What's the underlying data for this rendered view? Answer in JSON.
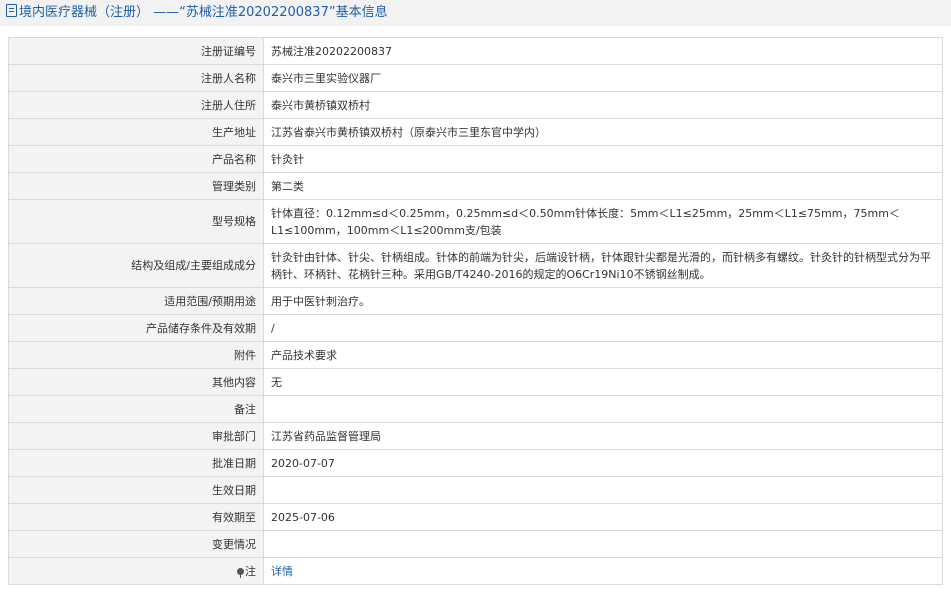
{
  "header": {
    "title": "境内医疗器械（注册） ——“苏械注准20202200837”基本信息",
    "icon": "document-icon"
  },
  "rows": [
    {
      "label": "注册证编号",
      "value": "苏械注准20202200837"
    },
    {
      "label": "注册人名称",
      "value": "泰兴市三里实验仪器厂"
    },
    {
      "label": "注册人住所",
      "value": "泰兴市黄桥镇双桥村"
    },
    {
      "label": "生产地址",
      "value": "江苏省泰兴市黄桥镇双桥村（原泰兴市三里东官中学内）"
    },
    {
      "label": "产品名称",
      "value": "针灸针"
    },
    {
      "label": "管理类别",
      "value": "第二类"
    },
    {
      "label": "型号规格",
      "value": "针体直径：0.12mm≤d＜0.25mm，0.25mm≤d＜0.50mm针体长度：5mm＜L1≤25mm，25mm＜L1≤75mm，75mm＜L1≤100mm，100mm＜L1≤200mm支/包装"
    },
    {
      "label": "结构及组成/主要组成成分",
      "value": "针灸针由针体、针尖、针柄组成。针体的前端为针尖，后端设针柄，针体跟针尖都是光滑的，而针柄多有螺纹。针灸针的针柄型式分为平柄针、环柄针、花柄针三种。采用GB/T4240-2016的规定的O6Cr19Ni10不锈钢丝制成。"
    },
    {
      "label": "适用范围/预期用途",
      "value": "用于中医针刺治疗。"
    },
    {
      "label": "产品储存条件及有效期",
      "value": "/"
    },
    {
      "label": "附件",
      "value": "产品技术要求"
    },
    {
      "label": "其他内容",
      "value": "无"
    },
    {
      "label": "备注",
      "value": ""
    },
    {
      "label": "审批部门",
      "value": "江苏省药品监督管理局"
    },
    {
      "label": "批准日期",
      "value": "2020-07-07"
    },
    {
      "label": "生效日期",
      "value": ""
    },
    {
      "label": "有效期至",
      "value": "2025-07-06"
    },
    {
      "label": "变更情况",
      "value": ""
    }
  ],
  "note": {
    "label": "注",
    "icon": "pin-icon",
    "link_text": "详情"
  },
  "colors": {
    "title": "#1f5fa6",
    "label_bg": "#f3f3f3",
    "border": "#d9d9d9",
    "link": "#1f5fa6"
  }
}
